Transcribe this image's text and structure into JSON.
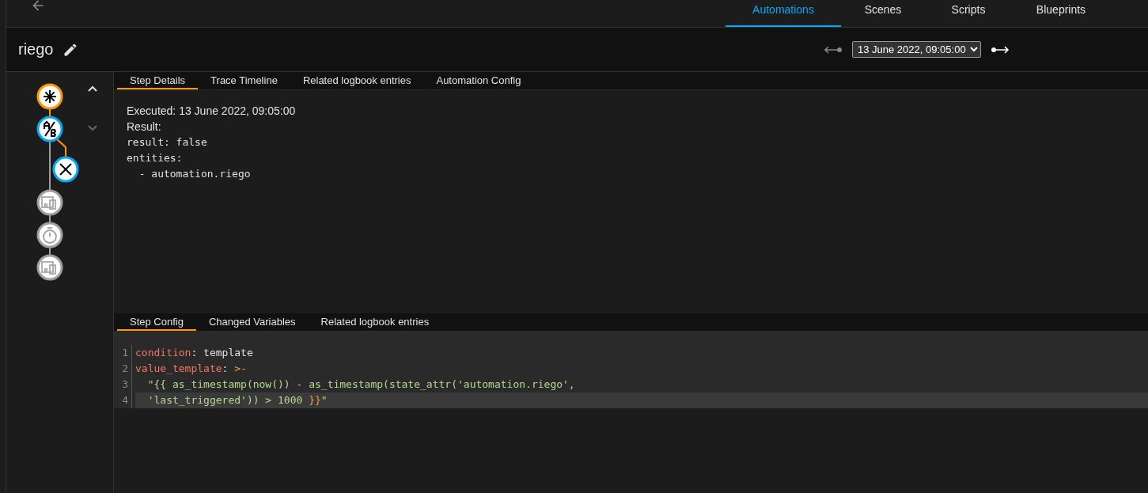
{
  "nav_tabs": [
    {
      "label": "Automations",
      "selected": true
    },
    {
      "label": "Scenes",
      "selected": false
    },
    {
      "label": "Scripts",
      "selected": false
    },
    {
      "label": "Blueprints",
      "selected": false
    }
  ],
  "title": "riego",
  "trace_select": {
    "value": "13 June 2022, 09:05:00"
  },
  "graph": {
    "nodes": [
      {
        "kind": "trigger",
        "color": "#ff9800"
      },
      {
        "kind": "condition",
        "color": "#03a9f4"
      },
      {
        "kind": "stop",
        "color": "#03a9f4"
      },
      {
        "kind": "device",
        "color": "#9e9e9e"
      },
      {
        "kind": "delay",
        "color": "#9e9e9e"
      },
      {
        "kind": "device",
        "color": "#9e9e9e"
      }
    ],
    "prev_disabled": false,
    "next_disabled": true
  },
  "detail_tabs": [
    {
      "label": "Step Details",
      "selected": true
    },
    {
      "label": "Trace Timeline",
      "selected": false
    },
    {
      "label": "Related logbook entries",
      "selected": false
    },
    {
      "label": "Automation Config",
      "selected": false
    }
  ],
  "details": {
    "executed": "Executed: 13 June 2022, 09:05:00",
    "result_label": "Result:",
    "yaml": [
      "result: false",
      "entities:",
      "  - automation.riego"
    ]
  },
  "config_tabs": [
    {
      "label": "Step Config",
      "selected": true
    },
    {
      "label": "Changed Variables",
      "selected": false
    },
    {
      "label": "Related logbook entries",
      "selected": false
    }
  ],
  "code": [
    {
      "number": "1",
      "active": false,
      "tokens": [
        {
          "kind": "key",
          "text": "condition"
        },
        {
          "kind": "plain",
          "text": ": template"
        }
      ]
    },
    {
      "number": "2",
      "active": false,
      "tokens": [
        {
          "kind": "key",
          "text": "value_template"
        },
        {
          "kind": "plain",
          "text": ": "
        },
        {
          "kind": "op",
          "text": ">-"
        }
      ]
    },
    {
      "number": "3",
      "active": false,
      "tokens": [
        {
          "kind": "string",
          "text": "  \"{{ as_timestamp(now()) - as_timestamp(state_attr('automation.riego',"
        }
      ]
    },
    {
      "number": "4",
      "active": true,
      "tokens": [
        {
          "kind": "string",
          "text": "  'last_triggered')) > 1000 "
        },
        {
          "kind": "op",
          "text": "}}"
        },
        {
          "kind": "string",
          "text": "\""
        }
      ]
    }
  ]
}
